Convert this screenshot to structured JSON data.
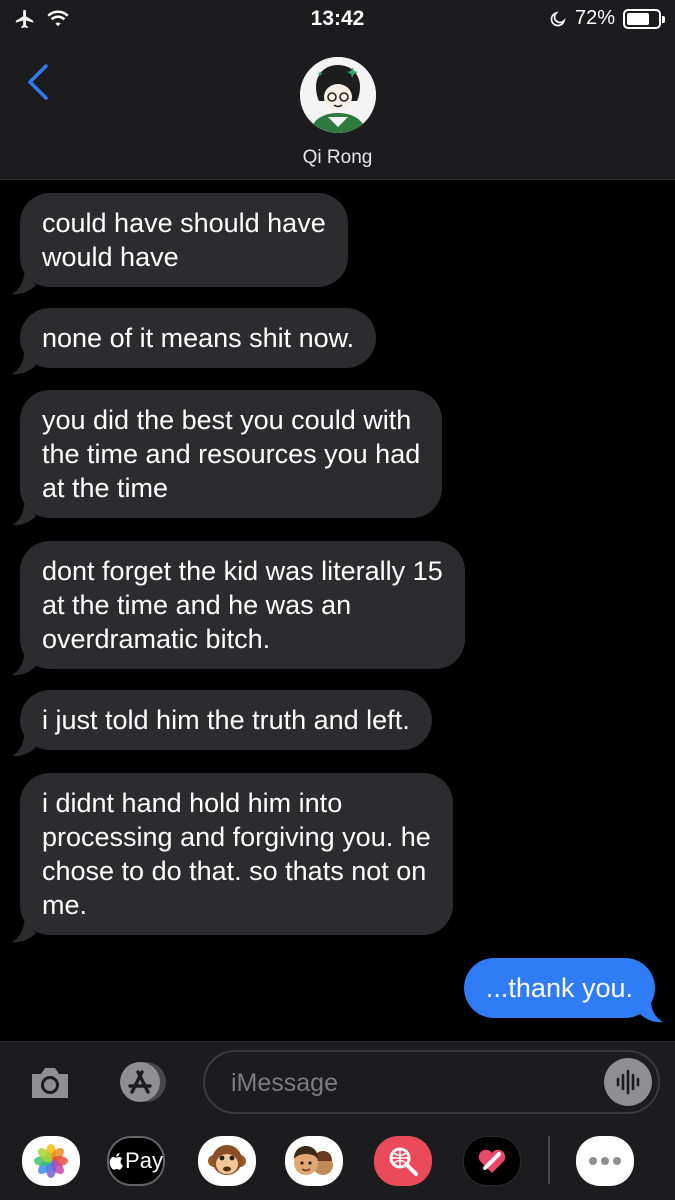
{
  "status_bar": {
    "time": "13:42",
    "battery_percent_label": "72%",
    "battery_level": 0.72,
    "icons": [
      "airplane-icon",
      "wifi-icon",
      "moon-icon",
      "battery-icon"
    ]
  },
  "header": {
    "contact_name": "Qi Rong",
    "back_icon": "chevron-left-icon"
  },
  "messages": [
    {
      "direction": "incoming",
      "text": "could have should have\nwould have"
    },
    {
      "direction": "incoming",
      "text": "none of it means shit now."
    },
    {
      "direction": "incoming",
      "text": "you did the best you could with\nthe time and resources you had\nat the time"
    },
    {
      "direction": "incoming",
      "text": "dont forget the kid was literally 15\nat the time and he was an\noverdramatic bitch."
    },
    {
      "direction": "incoming",
      "text": "i just told him the truth and left."
    },
    {
      "direction": "incoming",
      "text": "i didnt hand hold him into\nprocessing and forgiving you. he\nchose to do that. so thats not on\nme."
    },
    {
      "direction": "outgoing",
      "text": "...thank you."
    }
  ],
  "input": {
    "placeholder": "iMessage"
  },
  "app_drawer": {
    "apple_pay_label": "Pay",
    "apps": [
      "photos-icon",
      "apple-pay-icon",
      "animoji-monkey-icon",
      "memoji-icon",
      "web-search-icon",
      "digital-touch-icon",
      "more-icon"
    ]
  },
  "colors": {
    "outgoing_bubble": "#2f7cf6",
    "incoming_bubble": "#2c2c2e",
    "accent": "#2f7cf6"
  }
}
